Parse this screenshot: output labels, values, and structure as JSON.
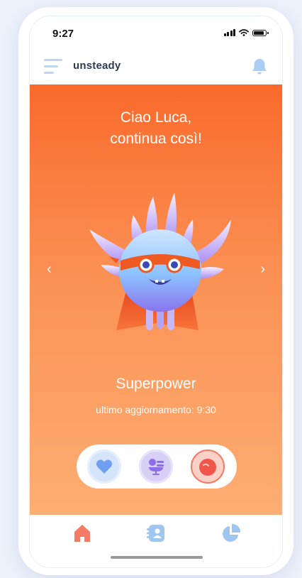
{
  "status_bar": {
    "time": "9:27"
  },
  "header": {
    "brand": "unsteady",
    "menu_icon": "hamburger-menu-icon",
    "notification_icon": "bell-icon"
  },
  "hero": {
    "greeting_line1": "Ciao Luca,",
    "greeting_line2": "continua così!",
    "prev_arrow": "‹",
    "next_arrow": "›",
    "mascot_name": "Superpower",
    "last_update": "ultimo aggiornamento: 9:30",
    "colors": {
      "gradient_top": "#fa6a2c",
      "gradient_bottom": "#fdae73"
    }
  },
  "actions": [
    {
      "icon": "heart-icon",
      "color": "#6e9ff0"
    },
    {
      "icon": "mood-icon",
      "color": "#8b6fe6"
    },
    {
      "icon": "pomegranate-icon",
      "color": "#f0564a"
    }
  ],
  "tabs": [
    {
      "icon": "home-icon",
      "color": "#f47a66",
      "active": true
    },
    {
      "icon": "diary-icon",
      "color": "#9fc6f0",
      "active": false
    },
    {
      "icon": "pie-chart-icon",
      "color": "#9fc6f0",
      "active": false
    }
  ]
}
